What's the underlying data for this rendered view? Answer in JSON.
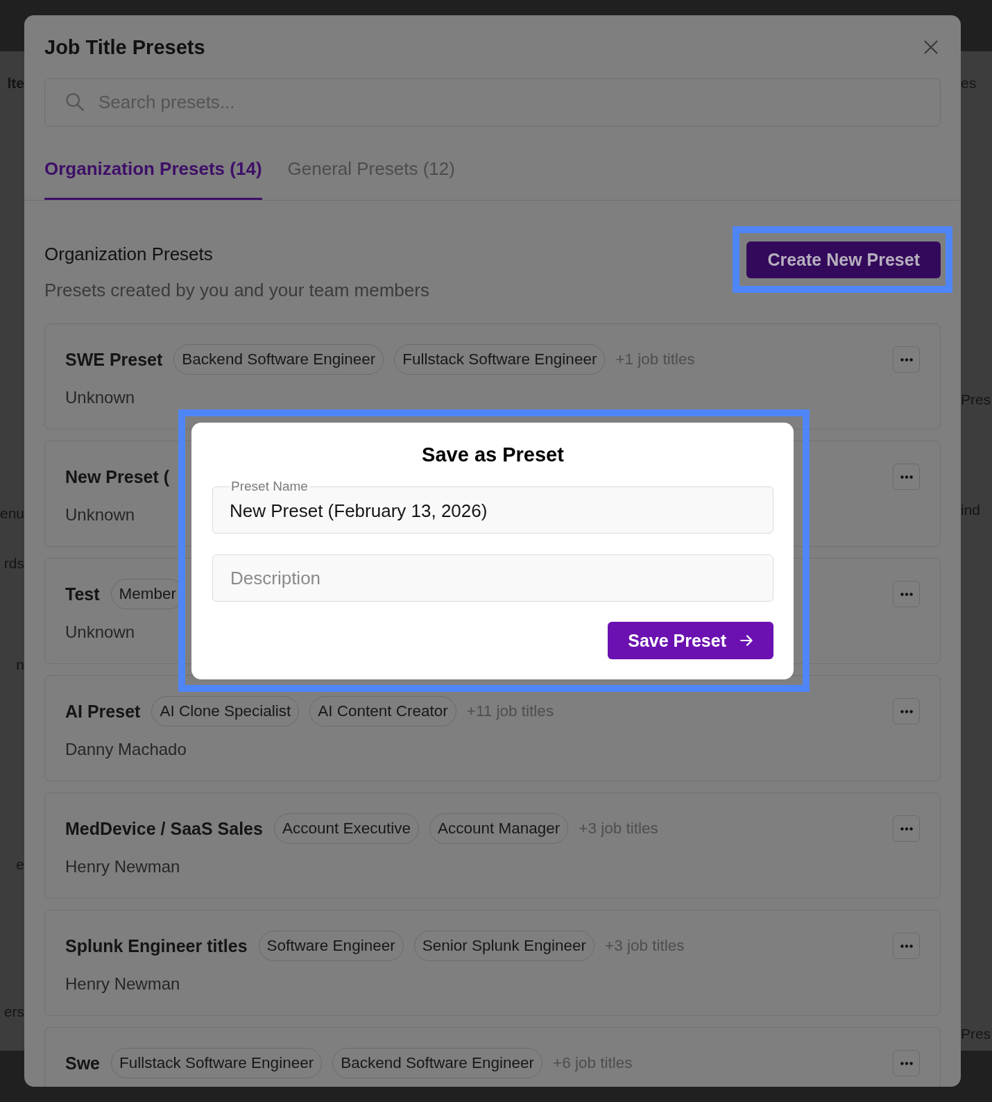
{
  "background_page": {
    "left_fragments": [
      "lte",
      "enu",
      "rds",
      "n",
      "e",
      "ers"
    ],
    "right_fragments": [
      "es",
      "Pres",
      "ind",
      "Pres"
    ]
  },
  "presets_dialog": {
    "title": "Job Title Presets",
    "search": {
      "placeholder": "Search presets..."
    },
    "tabs": [
      {
        "label": "Organization Presets (14)",
        "selected": true
      },
      {
        "label": "General Presets (12)",
        "selected": false
      }
    ],
    "section": {
      "title": "Organization Presets",
      "subtitle": "Presets created by you and your team members",
      "create_button": {
        "label": "Create New Preset",
        "highlighted": true
      }
    },
    "presets": [
      {
        "name": "SWE Preset",
        "job_titles": [
          "Backend Software Engineer",
          "Fullstack Software Engineer"
        ],
        "more_titles": "+1 job titles",
        "author": "Unknown"
      },
      {
        "name": "New Preset (",
        "author": "Unknown"
      },
      {
        "name": "Test",
        "job_titles": [
          "Member"
        ],
        "author": "Unknown"
      },
      {
        "name": "AI Preset",
        "job_titles": [
          "AI Clone Specialist",
          "AI Content Creator"
        ],
        "more_titles": "+11 job titles",
        "author": "Danny Machado"
      },
      {
        "name": "MedDevice / SaaS Sales",
        "job_titles": [
          "Account Executive",
          "Account Manager"
        ],
        "more_titles": "+3 job titles",
        "author": "Henry Newman"
      },
      {
        "name": "Splunk Engineer titles",
        "job_titles": [
          "Software Engineer",
          "Senior Splunk Engineer"
        ],
        "more_titles": "+3 job titles",
        "author": "Henry Newman"
      },
      {
        "name": "Swe",
        "job_titles": [
          "Fullstack Software Engineer",
          "Backend Software Engineer"
        ],
        "more_titles": "+6 job titles"
      }
    ]
  },
  "save_dialog": {
    "title": "Save as Preset",
    "highlighted": true,
    "name_field": {
      "label": "Preset Name",
      "value": "New Preset (February 13, 2026)"
    },
    "description_field": {
      "placeholder": "Description"
    },
    "save_button": {
      "label": "Save Preset"
    }
  }
}
